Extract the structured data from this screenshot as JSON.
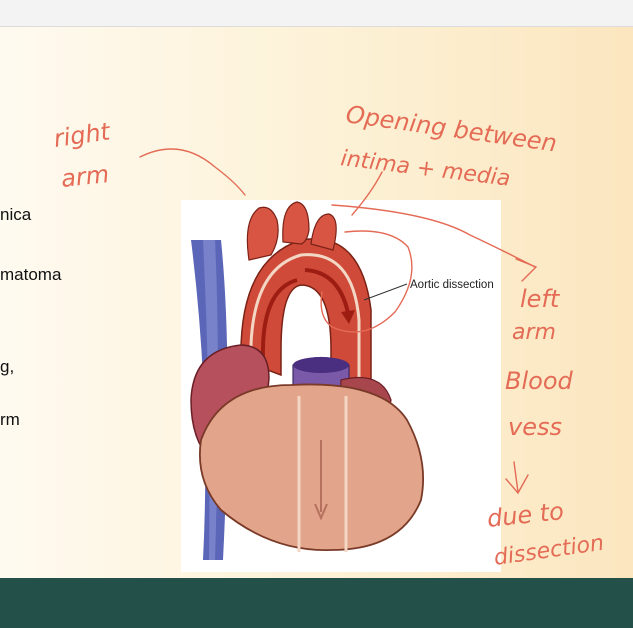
{
  "window": {
    "title": ""
  },
  "slide": {
    "body_lines": [
      "nica",
      "matoma",
      "g,",
      "rm"
    ]
  },
  "figure": {
    "label": "Aortic dissection",
    "subject": "heart-with-aortic-dissection"
  },
  "annotations": {
    "right_arm": [
      "right",
      "arm"
    ],
    "opening": [
      "Opening between",
      "intima + media"
    ],
    "left_arm": [
      "left",
      "arm"
    ],
    "blood_vessel": [
      "Blood",
      "vess"
    ],
    "due_to": [
      "due to",
      "dissection"
    ],
    "ink_color": "#e46b55"
  },
  "colors": {
    "footer": "#24504a",
    "slide_gradient_start": "#fffaf0",
    "slide_gradient_end": "#fbe6bf"
  }
}
